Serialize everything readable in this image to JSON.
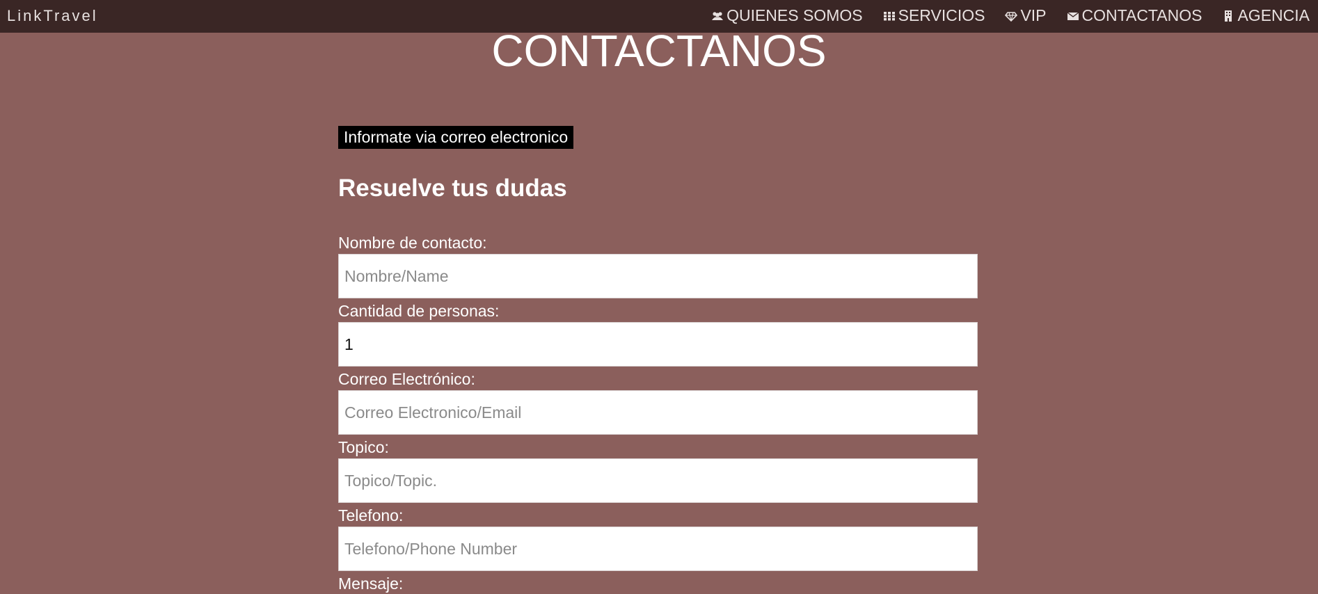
{
  "navbar": {
    "brand": "LinkTravel",
    "items": [
      {
        "label": "QUIENES SOMOS",
        "icon": "users-icon"
      },
      {
        "label": "SERVICIOS",
        "icon": "grid-icon"
      },
      {
        "label": "VIP",
        "icon": "diamond-icon"
      },
      {
        "label": "CONTACTANOS",
        "icon": "envelope-icon"
      },
      {
        "label": "AGENCIA",
        "icon": "building-icon"
      }
    ]
  },
  "page": {
    "title": "CONTACTANOS",
    "info_box": "Informate via correo electronico",
    "subtitle": "Resuelve tus dudas"
  },
  "form": {
    "name_label": "Nombre de contacto:",
    "name_placeholder": "Nombre/Name",
    "people_label": "Cantidad de personas:",
    "people_value": "1",
    "email_label": "Correo Electrónico:",
    "email_placeholder": "Correo Electronico/Email",
    "topic_label": "Topico:",
    "topic_placeholder": "Topico/Topic.",
    "phone_label": "Telefono:",
    "phone_placeholder": "Telefono/Phone Number",
    "message_label": "Mensaje:"
  },
  "colors": {
    "navbar_bg": "#3a2625",
    "page_bg": "#8b5f5c",
    "info_box_bg": "#000000"
  }
}
